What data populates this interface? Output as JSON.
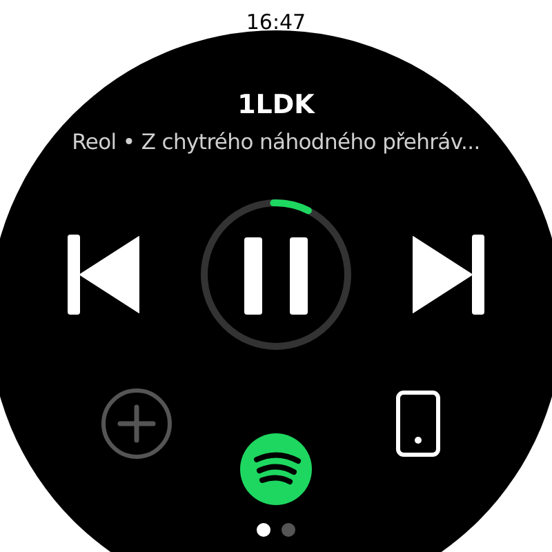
{
  "status_bar": {
    "time": "16:47"
  },
  "track": {
    "title": "1LDK",
    "subtitle": "Reol • Z chytrého náhodného přehráv..."
  },
  "playback": {
    "level": 0.08
  },
  "pages": [
    {
      "selected": true
    },
    {
      "selected": false
    }
  ]
}
